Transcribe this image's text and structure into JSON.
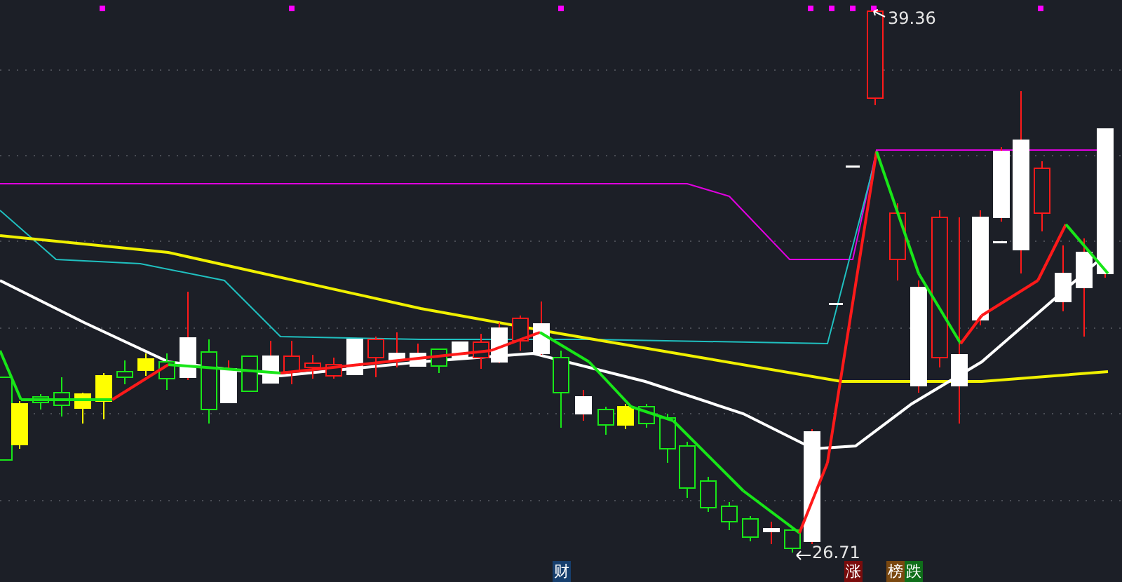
{
  "price_labels": [
    {
      "kind": "high",
      "text": "39.36"
    },
    {
      "kind": "low",
      "text": "26.71"
    }
  ],
  "badges": [
    {
      "text": "财",
      "color": "#173f6e"
    },
    {
      "text": "涨",
      "color": "#7a0c0c"
    },
    {
      "text": "榜",
      "color": "#7a4810"
    },
    {
      "text": "跌",
      "color": "#0f6e1a"
    }
  ]
}
